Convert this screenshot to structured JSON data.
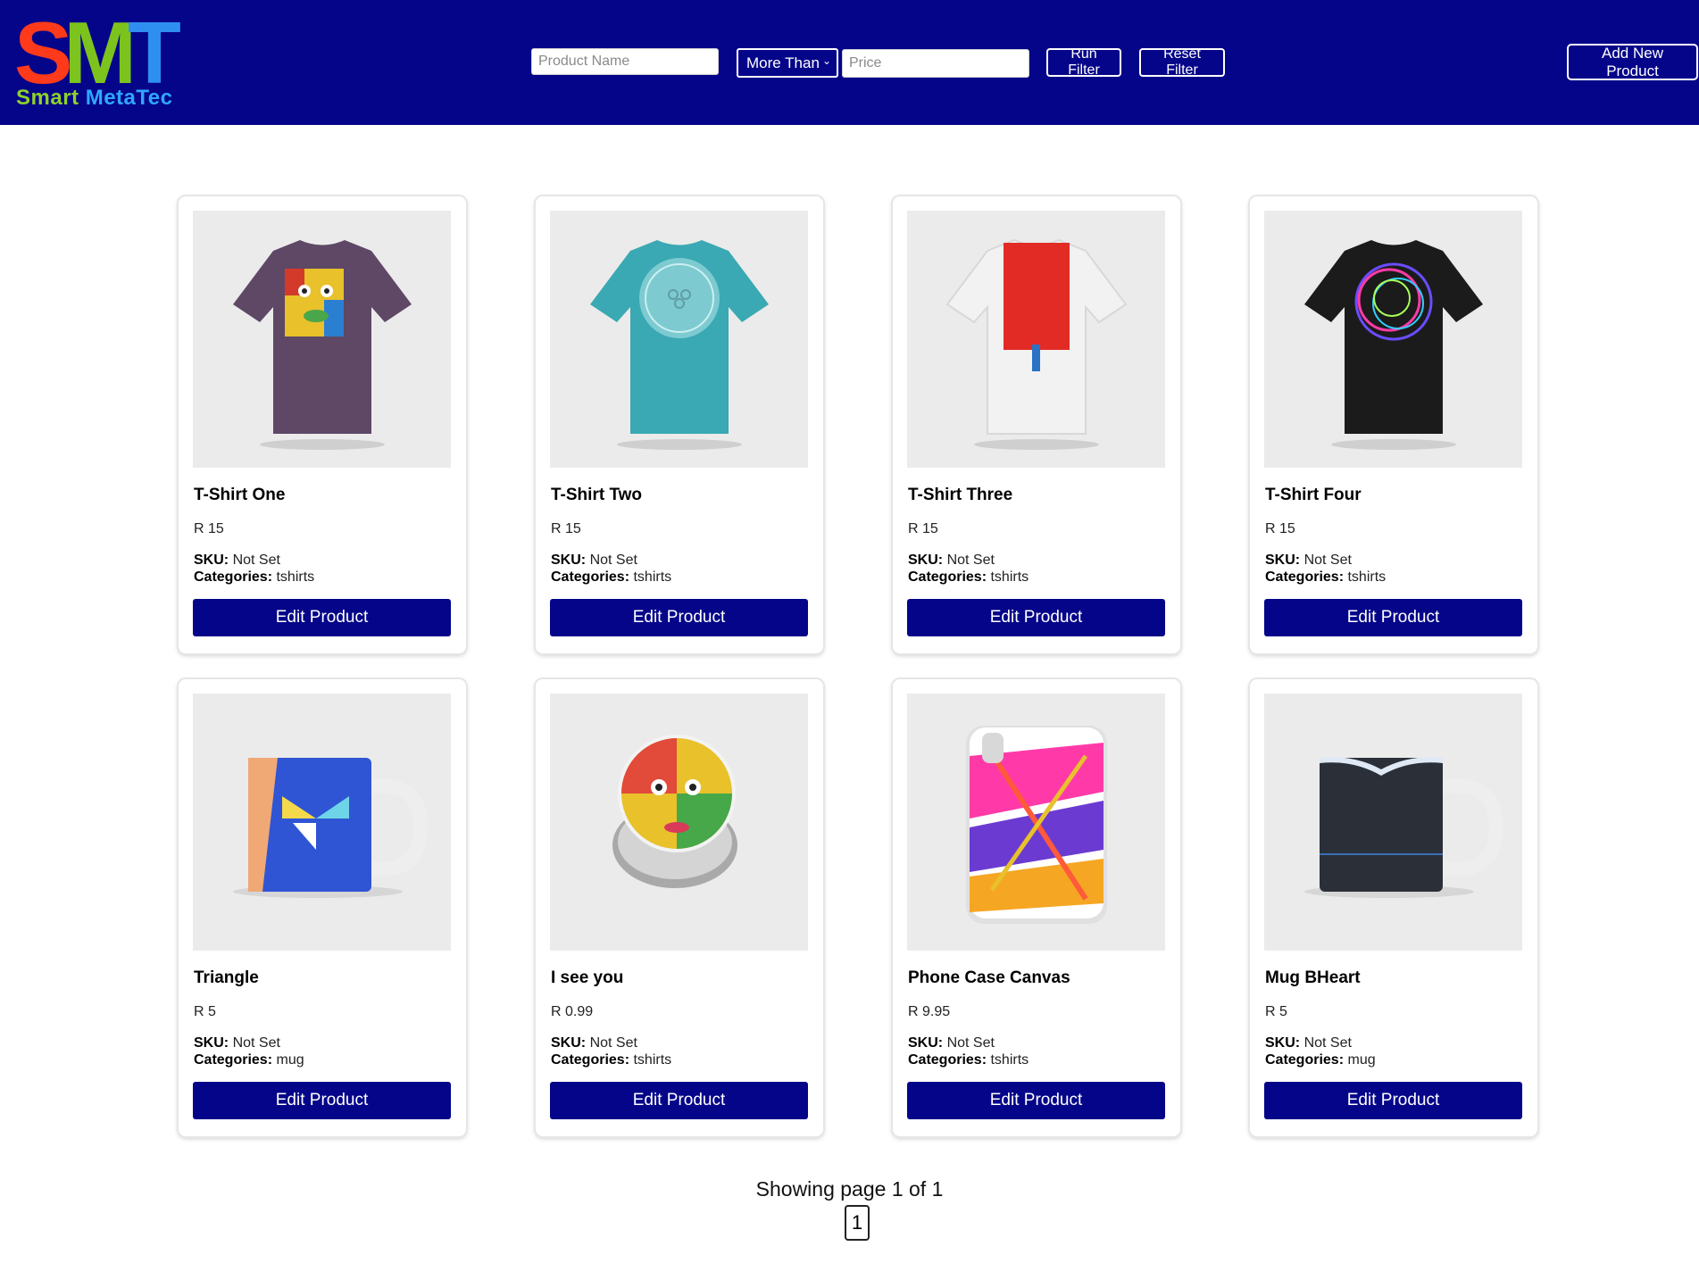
{
  "header": {
    "logo_text_large": "SMT",
    "logo_text_small_1": "Smart",
    "logo_text_small_2": "MetaTec",
    "product_name_placeholder": "Product Name",
    "comparison_select_value": "More Than",
    "price_placeholder": "Price",
    "run_filter_label": "Run Filter",
    "reset_filter_label": "Reset Filter",
    "add_product_label": "Add New Product"
  },
  "labels": {
    "sku": "SKU:",
    "categories": "Categories:"
  },
  "products": [
    {
      "title": "T-Shirt One",
      "price": "R 15",
      "sku": "Not Set",
      "categories": "tshirts",
      "edit_label": "Edit Product"
    },
    {
      "title": "T-Shirt Two",
      "price": "R 15",
      "sku": "Not Set",
      "categories": "tshirts",
      "edit_label": "Edit Product"
    },
    {
      "title": "T-Shirt Three",
      "price": "R 15",
      "sku": "Not Set",
      "categories": "tshirts",
      "edit_label": "Edit Product"
    },
    {
      "title": "T-Shirt Four",
      "price": "R 15",
      "sku": "Not Set",
      "categories": "tshirts",
      "edit_label": "Edit Product"
    },
    {
      "title": "Triangle",
      "price": "R 5",
      "sku": "Not Set",
      "categories": "mug",
      "edit_label": "Edit Product"
    },
    {
      "title": "I see you",
      "price": "R 0.99",
      "sku": "Not Set",
      "categories": "tshirts",
      "edit_label": "Edit Product"
    },
    {
      "title": "Phone Case Canvas",
      "price": "R 9.95",
      "sku": "Not Set",
      "categories": "tshirts",
      "edit_label": "Edit Product"
    },
    {
      "title": "Mug BHeart",
      "price": "R 5",
      "sku": "Not Set",
      "categories": "mug",
      "edit_label": "Edit Product"
    }
  ],
  "pagination": {
    "summary": "Showing page 1 of 1",
    "current_page": "1"
  },
  "colors": {
    "header_bg": "#05058a",
    "button_bg": "#05058a"
  }
}
